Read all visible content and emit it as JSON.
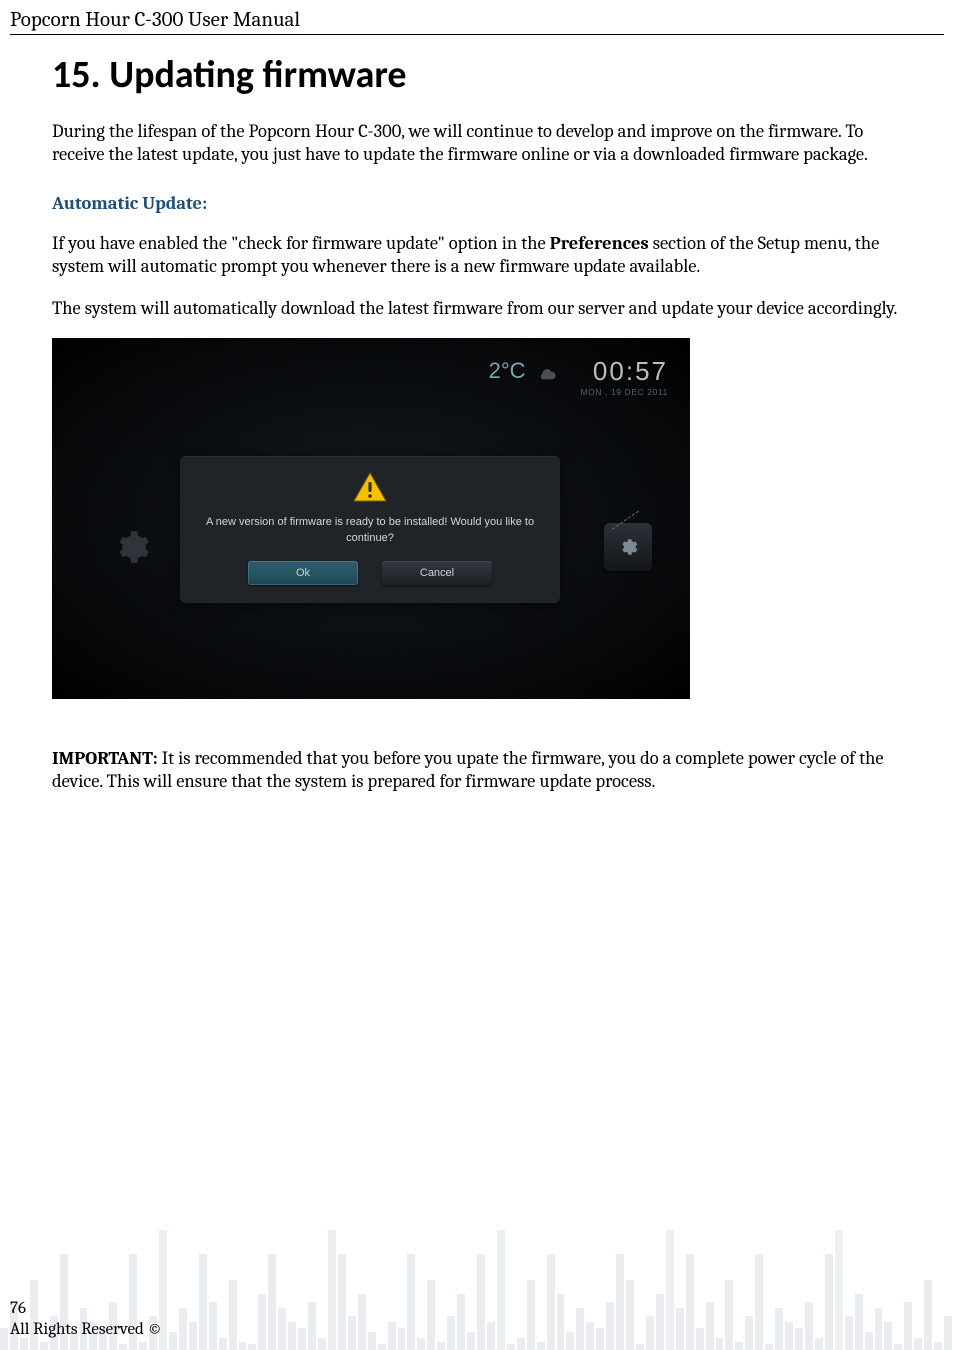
{
  "running_head": "Popcorn Hour C-300 User Manual",
  "title": "15. Updating firmware",
  "intro": "During the lifespan of the Popcorn Hour C-300, we will continue to develop and improve on the firmware. To receive the latest update, you just have to update the firmware online or via a downloaded firmware package.",
  "subhead": "Automatic Update:",
  "para1_a": "If you have enabled the \"check for firmware update\" option in the ",
  "para1_bold": "Preferences",
  "para1_b": " section of the Setup menu, the system will automatic prompt you whenever there is a new firmware update available.",
  "para2": "The system will automatically download the latest firmware from our server and update your device accordingly.",
  "screenshot": {
    "temperature": "2°C",
    "time": "00:57",
    "date": "MON , 19 DEC 2011",
    "dialog_msg": "A new version of firmware is ready to be installed! Would you like to continue?",
    "ok_label": "Ok",
    "cancel_label": "Cancel"
  },
  "important_lead": "IMPORTANT:",
  "important_rest": " It is recommended that you before you upate the firmware, you do a complete power cycle of the device. This will ensure that the system is prepared for firmware update process.",
  "footer": {
    "page_number": "76",
    "rights": "All Rights Reserved ©"
  }
}
